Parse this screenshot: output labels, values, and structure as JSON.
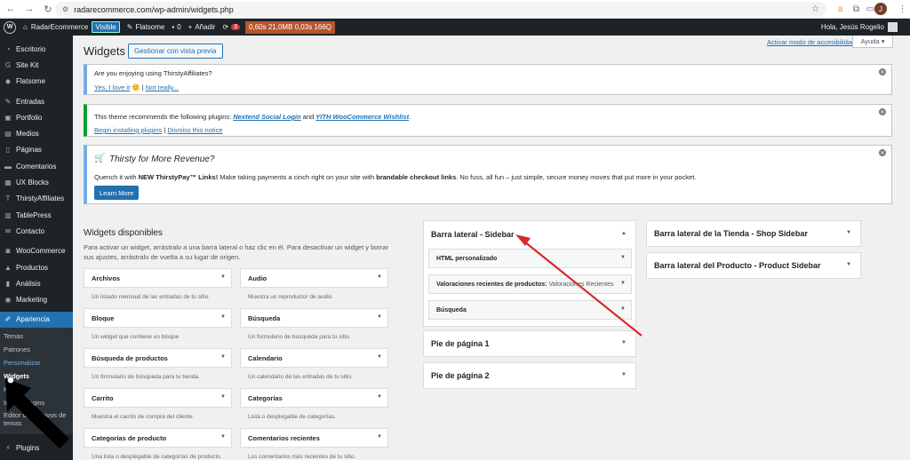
{
  "browser": {
    "url": "radarecommerce.com/wp-admin/widgets.php",
    "profile_initial": "J"
  },
  "adminbar": {
    "site_name": "RadarEcommerce",
    "visible_badge": "Visible",
    "theme": "Flatsome",
    "comments_count": "0",
    "add_new": "Añadir",
    "updates_count": "3",
    "perf_stats": "0,60s  21,0MB  0,03s  166Q",
    "greeting": "Hola, Jesús Rogelio"
  },
  "sidebar": {
    "items": [
      {
        "label": "Escritorio",
        "icon": "dashboard-icon"
      },
      {
        "label": "Site Kit",
        "icon": "sitekit-icon"
      },
      {
        "label": "Flatsome",
        "icon": "flatsome-icon"
      },
      {
        "label": "Entradas",
        "icon": "pin-icon"
      },
      {
        "label": "Portfolio",
        "icon": "portfolio-icon"
      },
      {
        "label": "Medios",
        "icon": "media-icon"
      },
      {
        "label": "Páginas",
        "icon": "pages-icon"
      },
      {
        "label": "Comentarios",
        "icon": "comments-icon"
      },
      {
        "label": "UX Blocks",
        "icon": "blocks-icon"
      },
      {
        "label": "ThirstyAffiliates",
        "icon": "thirsty-icon"
      },
      {
        "label": "TablePress",
        "icon": "table-icon"
      },
      {
        "label": "Contacto",
        "icon": "mail-icon"
      },
      {
        "label": "WooCommerce",
        "icon": "woo-icon"
      },
      {
        "label": "Productos",
        "icon": "products-icon"
      },
      {
        "label": "Análisis",
        "icon": "analytics-icon"
      },
      {
        "label": "Marketing",
        "icon": "marketing-icon"
      },
      {
        "label": "Apariencia",
        "icon": "brush-icon"
      }
    ],
    "submenu": [
      "Temas",
      "Patrones",
      "Personalizar",
      "Widgets",
      "Menús",
      "Install Plugins",
      "Editor de archivos de temas"
    ],
    "plugins_label": "Plugins"
  },
  "header": {
    "title": "Widgets",
    "preview_button": "Gestionar con vista previa",
    "accessibility_link": "Activar modo de accesibilidad",
    "help_tab": "Ayuda"
  },
  "notices": {
    "n1": {
      "text": "Are you enjoying using ThirstyAffiliates?",
      "yes": "Yes, I love it",
      "no": "Not really..."
    },
    "n2": {
      "prefix": "This theme recommends the following plugins: ",
      "plugin1": "Nextend Social Login",
      "and": " and ",
      "plugin2": "YITH WooCommerce Wishlist",
      "suffix": ".",
      "install_link": "Begin installing plugins",
      "dismiss_link": "Dismiss this notice"
    },
    "n3": {
      "title": "Thirsty for More Revenue?",
      "desc_a": "Quench it with ",
      "desc_b": "NEW ThirstyPay™ Links!",
      "desc_c": " Make taking payments a cinch right on your site with ",
      "desc_d": "brandable checkout links",
      "desc_e": ". No fuss, all fun – just simple, secure money moves that put more in your pocket.",
      "button": "Learn More"
    }
  },
  "available": {
    "title": "Widgets disponibles",
    "desc": "Para activar un widget, arrástralo a una barra lateral o haz clic en él. Para desactivar un widget y borrar sus ajustes, arrástralo de vuelta a su lugar de origen.",
    "widgets": [
      {
        "name": "Archivos",
        "desc": "Un listado mensual de las entradas de tu sitio."
      },
      {
        "name": "Audio",
        "desc": "Muestra un reproductor de audio."
      },
      {
        "name": "Bloque",
        "desc": "Un widget que contiene un bloque"
      },
      {
        "name": "Búsqueda",
        "desc": "Un formulario de búsqueda para tu sitio."
      },
      {
        "name": "Búsqueda de productos",
        "desc": "Un formulario de búsqueda para tu tienda."
      },
      {
        "name": "Calendario",
        "desc": "Un calendario de las entradas de tu sitio."
      },
      {
        "name": "Carrito",
        "desc": "Muestra el carrito de compra del cliente."
      },
      {
        "name": "Categorías",
        "desc": "Lista o desplegable de categorías."
      },
      {
        "name": "Categorías de producto",
        "desc": "Una lista o desplegable de categorías de producto."
      },
      {
        "name": "Comentarios recientes",
        "desc": "Los comentarios más recientes de tu sitio."
      }
    ]
  },
  "areas": {
    "sidebar": {
      "title": "Barra lateral - Sidebar",
      "widgets": [
        {
          "name": "HTML personalizado",
          "sub": ""
        },
        {
          "name": "Valoraciones recientes de productos:",
          "sub": "Valoraciones Recientes"
        },
        {
          "name": "Búsqueda",
          "sub": ""
        }
      ]
    },
    "footer1": {
      "title": "Pie de página 1"
    },
    "footer2": {
      "title": "Pie de página 2"
    },
    "shop": {
      "title": "Barra lateral de la Tienda - Shop Sidebar"
    },
    "product": {
      "title": "Barra lateral del Producto - Product Sidebar"
    }
  },
  "annotation": {
    "arrow_color": "#d9292b"
  }
}
